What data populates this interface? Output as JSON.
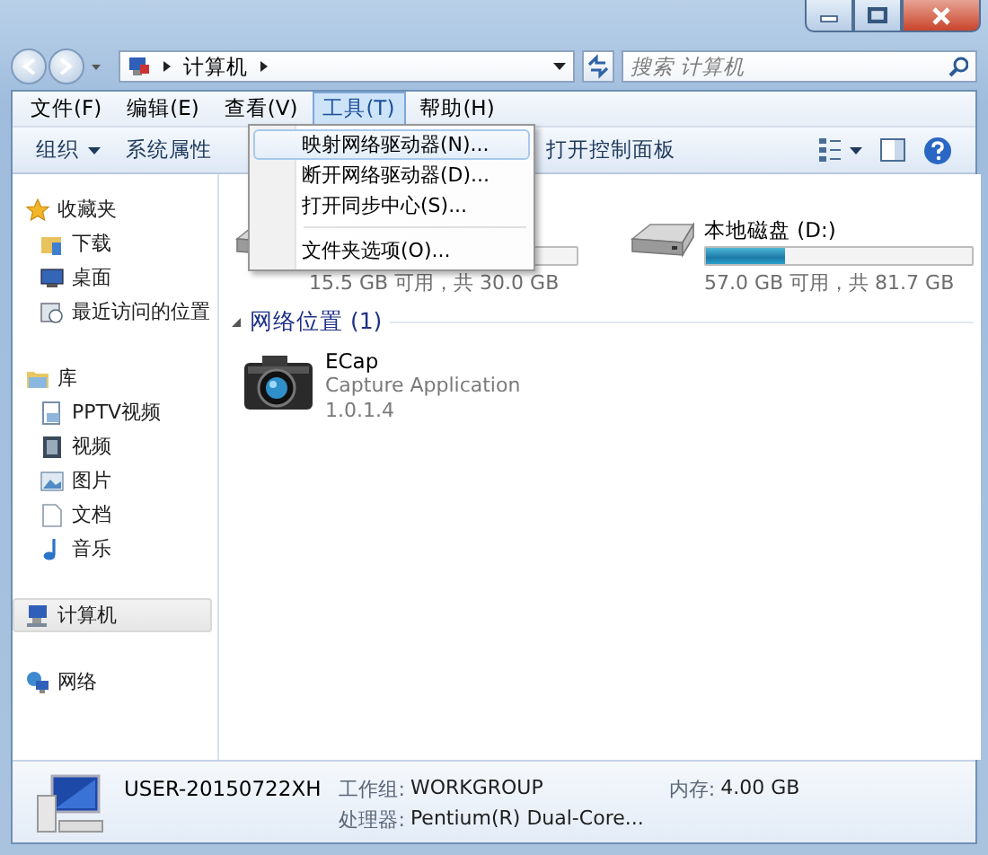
{
  "address": {
    "path": [
      "计算机"
    ]
  },
  "search": {
    "placeholder": "搜索 计算机"
  },
  "menu_bar": [
    {
      "label": "文件(F)",
      "selected": false
    },
    {
      "label": "编辑(E)",
      "selected": false
    },
    {
      "label": "查看(V)",
      "selected": false
    },
    {
      "label": "工具(T)",
      "selected": true
    },
    {
      "label": "帮助(H)",
      "selected": false
    }
  ],
  "dropdown_menu": [
    {
      "kind": "item",
      "label": "映射网络驱动器(N)...",
      "selected": true
    },
    {
      "kind": "item",
      "label": "断开网络驱动器(D)...",
      "selected": false
    },
    {
      "kind": "item",
      "label": "打开同步中心(S)...",
      "selected": false
    },
    {
      "kind": "separator"
    },
    {
      "kind": "item",
      "label": "文件夹选项(O)...",
      "selected": false
    }
  ],
  "toolbar": [
    {
      "kind": "dropdown",
      "label": "组织"
    },
    {
      "kind": "button",
      "label": "系统属性"
    },
    {
      "kind": "button",
      "label": "打开控制面板"
    }
  ],
  "navigation": [
    {
      "label": "收藏夹",
      "selected": false,
      "children": [
        {
          "label": "下载",
          "selected": false
        },
        {
          "label": "桌面",
          "selected": false
        },
        {
          "label": "最近访问的位置",
          "selected": false
        }
      ]
    },
    {
      "label": "库",
      "selected": false,
      "children": [
        {
          "label": "PPTV视频",
          "selected": false
        },
        {
          "label": "视频",
          "selected": false
        },
        {
          "label": "图片",
          "selected": false
        },
        {
          "label": "文档",
          "selected": false
        },
        {
          "label": "音乐",
          "selected": false
        }
      ]
    },
    {
      "label": "计算机",
      "selected": true
    },
    {
      "label": "网络",
      "selected": false
    }
  ],
  "drives": [
    {
      "space": "15.5 GB 可用，共 30.0 GB"
    },
    {
      "name": "本地磁盘 (D:)",
      "level": 0.3,
      "space": "57.0 GB 可用，共 81.7 GB"
    }
  ],
  "network_section": {
    "title": "网络位置 (1)",
    "expanded": true,
    "items": [
      {
        "name": "ECap",
        "lines": [
          "Capture Application",
          "1.0.1.4"
        ]
      }
    ]
  },
  "details": {
    "name": "USER-20150722XH",
    "fields": [
      {
        "label": "工作组:",
        "value": "WORKGROUP"
      },
      {
        "label": "内存:",
        "value": "4.00 GB"
      },
      {
        "label": "处理器:",
        "value": "Pentium(R) Dual-Core..."
      }
    ]
  }
}
